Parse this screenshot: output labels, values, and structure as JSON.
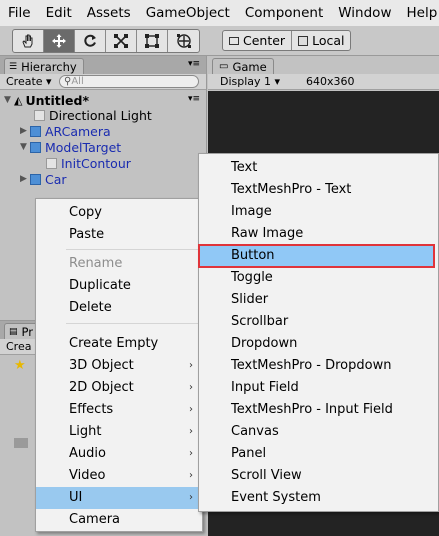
{
  "menubar": [
    "File",
    "Edit",
    "Assets",
    "GameObject",
    "Component",
    "Window",
    "Help"
  ],
  "toolbar": {
    "tools": [
      "hand-icon",
      "move-icon",
      "rotate-icon",
      "scale-icon",
      "rect-icon",
      "transform-icon"
    ],
    "pivot_center": "Center",
    "pivot_local": "Local"
  },
  "hierarchy": {
    "tab_label": "Hierarchy",
    "create_label": "Create",
    "search_placeholder": "All",
    "scene_name": "Untitled*",
    "items": [
      "Directional Light",
      "ARCamera",
      "ModelTarget",
      "InitContour",
      "Car"
    ]
  },
  "game": {
    "tab_label": "Game",
    "display": "Display 1",
    "resolution": "640x360"
  },
  "project": {
    "tab_label": "Pr",
    "create_label": "Crea"
  },
  "context_menu": {
    "items": [
      "Copy",
      "Paste",
      "Rename",
      "Duplicate",
      "Delete",
      "Create Empty",
      "3D Object",
      "2D Object",
      "Effects",
      "Light",
      "Audio",
      "Video",
      "UI",
      "Camera"
    ],
    "disabled": [
      "Rename"
    ],
    "highlighted": "UI"
  },
  "ui_submenu": {
    "items": [
      "Text",
      "TextMeshPro - Text",
      "Image",
      "Raw Image",
      "Button",
      "Toggle",
      "Slider",
      "Scrollbar",
      "Dropdown",
      "TextMeshPro - Dropdown",
      "Input Field",
      "TextMeshPro - Input Field",
      "Canvas",
      "Panel",
      "Scroll View",
      "Event System"
    ],
    "highlighted": "Button"
  },
  "colors": {
    "highlight": "#99c9ef",
    "outline": "#e0343a",
    "scene_blue": "#1a2cb0"
  }
}
